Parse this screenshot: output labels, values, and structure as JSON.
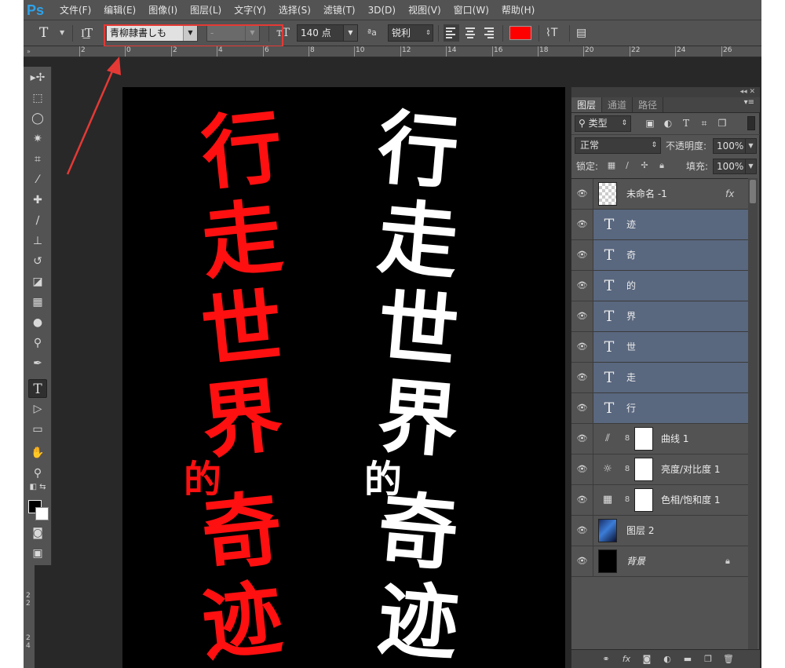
{
  "menubar": {
    "logo": "Ps",
    "items": [
      "文件(F)",
      "编辑(E)",
      "图像(I)",
      "图层(L)",
      "文字(Y)",
      "选择(S)",
      "滤镜(T)",
      "3D(D)",
      "视图(V)",
      "窗口(W)",
      "帮助(H)"
    ]
  },
  "options": {
    "tool_glyph": "T",
    "font_family": "青柳隷書しも",
    "font_style": "-",
    "font_size": "140 点",
    "antialias_icon": "ªa",
    "antialias": "锐利",
    "text_color": "#ff0000"
  },
  "ruler": {
    "labels": [
      "2",
      "0",
      "2",
      "4",
      "6",
      "8",
      "10",
      "12",
      "14",
      "16",
      "18",
      "20",
      "22",
      "24",
      "26"
    ],
    "vertical_labels": [
      "2",
      "2",
      "2",
      "4"
    ]
  },
  "canvas": {
    "red_big_chars": [
      "行",
      "走",
      "世",
      "界"
    ],
    "red_small_char": "的",
    "red_tail_chars": [
      "奇",
      "迹"
    ],
    "white_big_chars": [
      "行",
      "走",
      "世",
      "界"
    ],
    "white_small_char": "的",
    "white_tail_chars": [
      "奇",
      "迹"
    ],
    "red_color": "#ff1010",
    "white_color": "#ffffff"
  },
  "panel": {
    "tabs": [
      "图层",
      "通道",
      "路径"
    ],
    "filter": "类型",
    "blend_mode": "正常",
    "opacity_label": "不透明度:",
    "opacity": "100%",
    "lock_label": "锁定:",
    "fill_label": "填充:",
    "fill": "100%",
    "layers": [
      {
        "name": "未命名 -1",
        "kind": "smart",
        "fx": "fx"
      },
      {
        "name": "迹",
        "kind": "text",
        "glyph": "T"
      },
      {
        "name": "奇",
        "kind": "text",
        "glyph": "T"
      },
      {
        "name": "的",
        "kind": "text",
        "glyph": "T"
      },
      {
        "name": "界",
        "kind": "text",
        "glyph": "T"
      },
      {
        "name": "世",
        "kind": "text",
        "glyph": "T"
      },
      {
        "name": "走",
        "kind": "text",
        "glyph": "T"
      },
      {
        "name": "行",
        "kind": "text",
        "glyph": "T"
      },
      {
        "name": "曲线 1",
        "kind": "adjustment",
        "icon": "curves-icon"
      },
      {
        "name": "亮度/对比度 1",
        "kind": "adjustment",
        "icon": "brightness-icon"
      },
      {
        "name": "色相/饱和度 1",
        "kind": "adjustment",
        "icon": "hue-saturation-icon"
      },
      {
        "name": "图层 2",
        "kind": "photo"
      },
      {
        "name": "背景",
        "kind": "background"
      }
    ]
  },
  "colors": {
    "accent_highlight": "#e53935",
    "selected_layer": "#59677f",
    "ps_blue": "#2ea2ea"
  }
}
